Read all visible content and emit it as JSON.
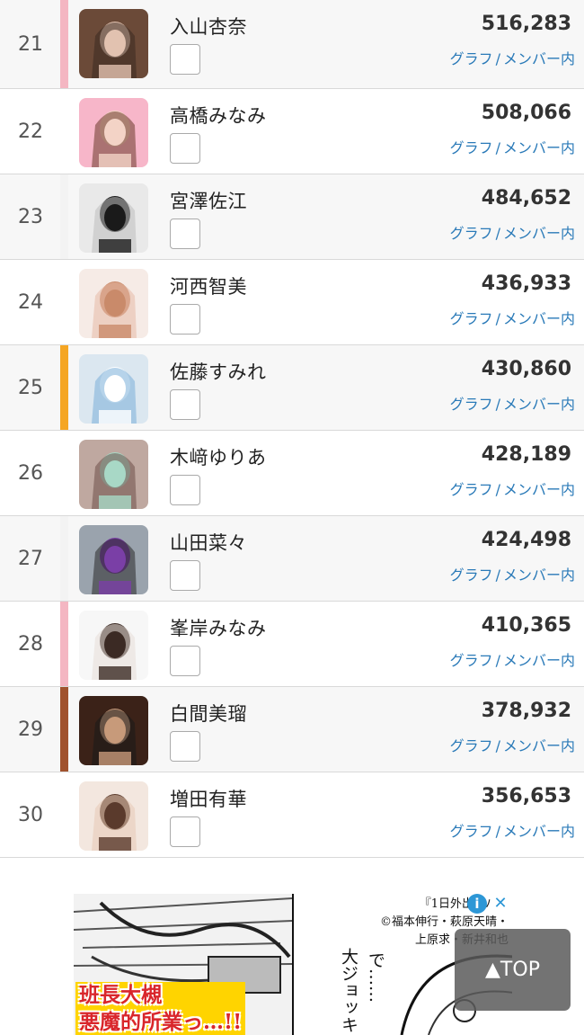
{
  "members": [
    {
      "rank": "21",
      "name": "入山杏奈",
      "votes": "516,283",
      "bar_color": "#f4b6c2",
      "photo": "rose"
    },
    {
      "rank": "22",
      "name": "高橋みなみ",
      "votes": "508,066",
      "bar_color": "",
      "photo": "pink"
    },
    {
      "rank": "23",
      "name": "宮澤佐江",
      "votes": "484,652",
      "bar_color": "#f3f3f3",
      "photo": "mono"
    },
    {
      "rank": "24",
      "name": "河西智美",
      "votes": "436,933",
      "bar_color": "",
      "photo": "peach"
    },
    {
      "rank": "25",
      "name": "佐藤すみれ",
      "votes": "430,860",
      "bar_color": "#f5a623",
      "photo": "sky"
    },
    {
      "rank": "26",
      "name": "木﨑ゆりあ",
      "votes": "428,189",
      "bar_color": "",
      "photo": "mint"
    },
    {
      "rank": "27",
      "name": "山田菜々",
      "votes": "424,498",
      "bar_color": "#f3f3f3",
      "photo": "purple"
    },
    {
      "rank": "28",
      "name": "峯岸みなみ",
      "votes": "410,365",
      "bar_color": "#f4b6c2",
      "photo": "white"
    },
    {
      "rank": "29",
      "name": "白間美瑠",
      "votes": "378,932",
      "bar_color": "#a0522d",
      "photo": "dark"
    },
    {
      "rank": "30",
      "name": "増田有華",
      "votes": "356,653",
      "bar_color": "",
      "photo": "skin"
    }
  ],
  "links": {
    "graph": "グラフ",
    "separator": "/",
    "members": "メンバー内"
  },
  "ad": {
    "caption_line1": "『1日外出録ハン",
    "caption_line2": "©福本伸行・萩原天晴・",
    "caption_line3": "上原求・新井和也",
    "headline_line1": "班長大槻",
    "headline_line2": "悪魔的所業っ…!!",
    "vertical_text1": "大ジョッキ",
    "vertical_text2": "で……",
    "info_symbol": "i",
    "close_symbol": "✕"
  },
  "top_button": {
    "label": "▲TOP"
  }
}
